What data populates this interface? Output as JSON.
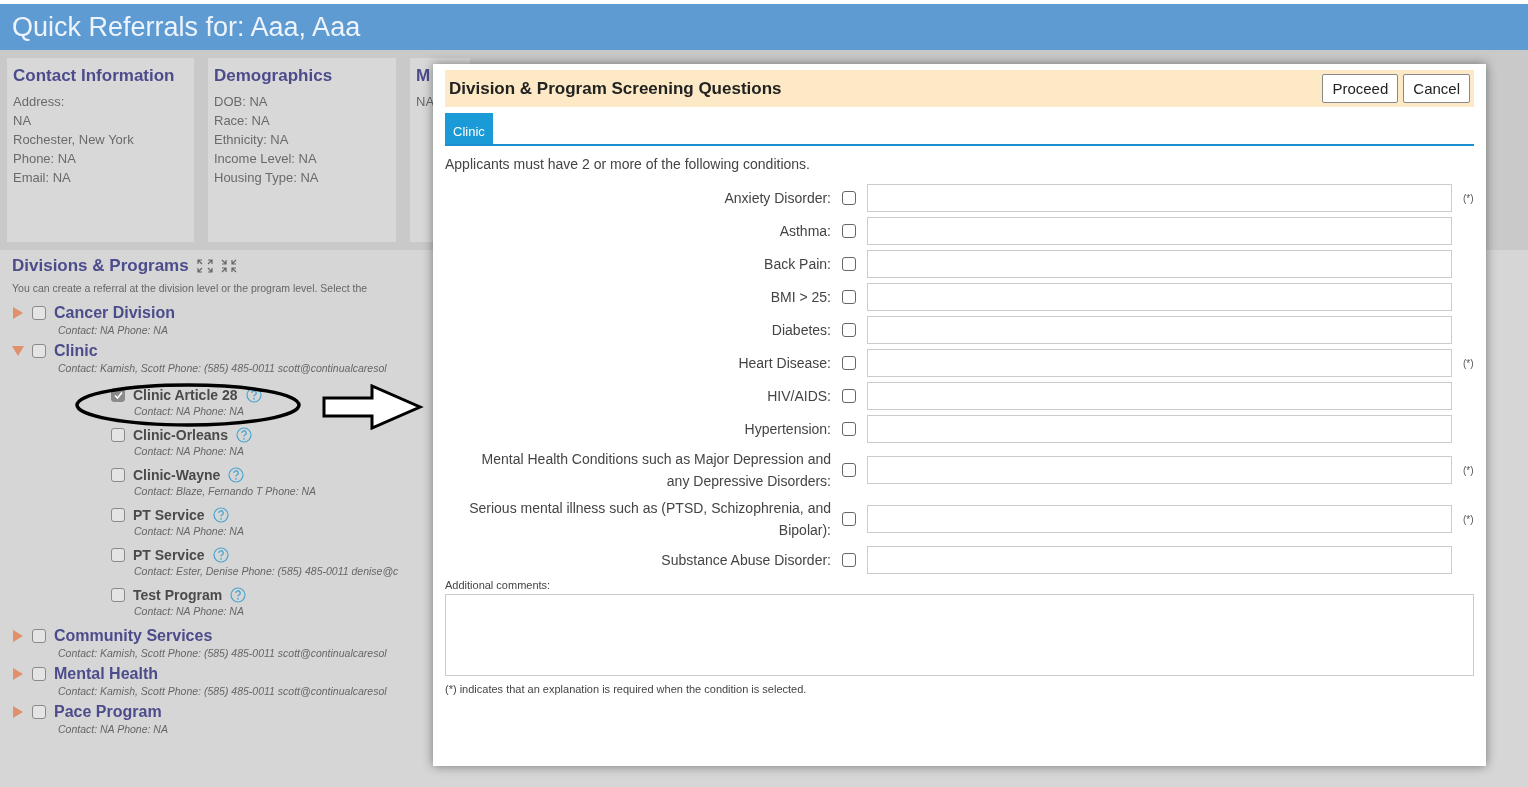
{
  "header": {
    "title": "Quick Referrals for: Aaa, Aaa"
  },
  "cards": [
    {
      "title": "Contact Information",
      "lines": [
        "Address:",
        "NA",
        "Rochester, New York",
        "Phone: NA",
        "Email: NA"
      ]
    },
    {
      "title": "Demographics",
      "lines": [
        "DOB: NA",
        "Race: NA",
        "Ethnicity: NA",
        "Income Level: NA",
        "Housing Type: NA"
      ]
    },
    {
      "title": "M",
      "lines": [
        "NA"
      ]
    }
  ],
  "divisions": {
    "title": "Divisions & Programs",
    "description": "You can create a referral at the division level or the program level. Select the",
    "items": [
      {
        "name": "Cancer Division",
        "contact": "Contact: NA Phone: NA",
        "expanded": false,
        "checked": false
      },
      {
        "name": "Clinic",
        "contact": "Contact: Kamish, Scott Phone: (585) 485-0011 scott@continualcaresol",
        "expanded": true,
        "checked": false,
        "children": [
          {
            "name": "Clinic Article 28",
            "contact": "Contact: NA Phone: NA",
            "checked": true
          },
          {
            "name": "Clinic-Orleans",
            "contact": "Contact: NA Phone: NA",
            "checked": false
          },
          {
            "name": "Clinic-Wayne",
            "contact": "Contact: Blaze, Fernando T Phone: NA",
            "checked": false
          },
          {
            "name": "PT Service",
            "contact": "Contact: NA Phone: NA",
            "checked": false
          },
          {
            "name": "PT Service",
            "contact": "Contact: Ester, Denise Phone: (585) 485-0011 denise@c",
            "checked": false
          },
          {
            "name": "Test Program",
            "contact": "Contact: NA Phone: NA",
            "checked": false
          }
        ]
      },
      {
        "name": "Community Services",
        "contact": "Contact: Kamish, Scott Phone: (585) 485-0011 scott@continualcaresol",
        "expanded": false,
        "checked": false
      },
      {
        "name": "Mental Health",
        "contact": "Contact: Kamish, Scott Phone: (585) 485-0011 scott@continualcaresol",
        "expanded": false,
        "checked": false
      },
      {
        "name": "Pace Program",
        "contact": "Contact: NA Phone: NA",
        "expanded": false,
        "checked": false
      }
    ]
  },
  "modal": {
    "title": "Division & Program Screening Questions",
    "buttons": [
      "Proceed",
      "Cancel"
    ],
    "tabs": [
      {
        "label": "Clinic",
        "selected": true
      }
    ],
    "intro": "Applicants must have 2 or more of the following conditions.",
    "questions": [
      {
        "label": "Anxiety Disorder:",
        "checked": false,
        "note": "(*)"
      },
      {
        "label": "Asthma:",
        "checked": false
      },
      {
        "label": "Back Pain:",
        "checked": false
      },
      {
        "label": "BMI > 25:",
        "checked": false
      },
      {
        "label": "Diabetes:",
        "checked": false
      },
      {
        "label": "Heart Disease:",
        "checked": false,
        "note": "(*)"
      },
      {
        "label": "HIV/AIDS:",
        "checked": false
      },
      {
        "label": "Hypertension:",
        "checked": false
      },
      {
        "label": "Mental Health Conditions such as Major Depression and any Depressive Disorders:",
        "checked": false,
        "note": "(*)"
      },
      {
        "label": "Serious mental illness such as (PTSD, Schizophrenia, and Bipolar):",
        "checked": false,
        "note": "(*)"
      },
      {
        "label": "Substance Abuse Disorder:",
        "checked": false
      }
    ],
    "comments_label": "Additional comments:",
    "footnote": "(*) indicates that an explanation is required when the condition is selected."
  }
}
